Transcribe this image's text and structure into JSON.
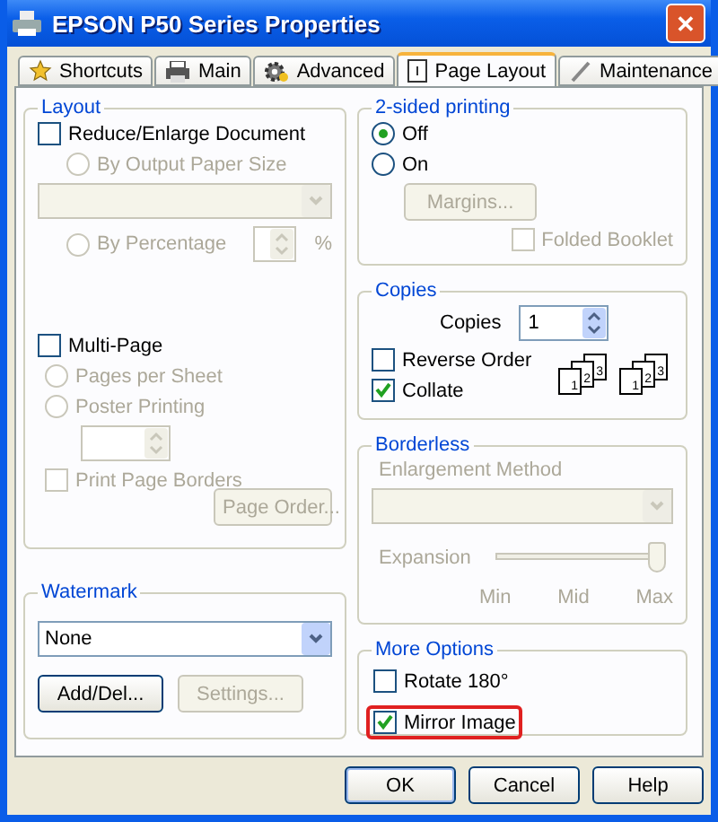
{
  "window": {
    "title": "EPSON P50 Series Properties",
    "close": "✕"
  },
  "tabs": [
    {
      "label": "Shortcuts",
      "selected": false
    },
    {
      "label": "Main",
      "selected": false
    },
    {
      "label": "Advanced",
      "selected": false
    },
    {
      "label": "Page Layout",
      "selected": true
    },
    {
      "label": "Maintenance",
      "selected": false
    }
  ],
  "layout": {
    "title": "Layout",
    "reduce_enlarge": {
      "label": "Reduce/Enlarge Document",
      "checked": false,
      "disabled": false
    },
    "by_output_paper_size": {
      "label": "By Output Paper Size",
      "selected": false,
      "disabled": true
    },
    "by_percentage": {
      "label": "By Percentage",
      "selected": false,
      "disabled": true
    },
    "percent_unit": "%",
    "multi_page": {
      "label": "Multi-Page",
      "checked": false,
      "disabled": false
    },
    "pages_per_sheet": {
      "label": "Pages per Sheet",
      "selected": false,
      "disabled": true
    },
    "poster_printing": {
      "label": "Poster Printing",
      "selected": false,
      "disabled": true
    },
    "print_page_borders": {
      "label": "Print Page Borders",
      "checked": false,
      "disabled": true
    },
    "page_order_button": {
      "label": "Page Order...",
      "disabled": true
    }
  },
  "watermark": {
    "title": "Watermark",
    "value": "None",
    "add_del_button": {
      "label": "Add/Del...",
      "disabled": false
    },
    "settings_button": {
      "label": "Settings...",
      "disabled": true
    }
  },
  "two_sided": {
    "title": "2-sided printing",
    "options": [
      {
        "label": "Off",
        "selected": true,
        "disabled": false
      },
      {
        "label": "On",
        "selected": false,
        "disabled": false
      }
    ],
    "margins_button": {
      "label": "Margins...",
      "disabled": true
    },
    "folded_booklet": {
      "label": "Folded Booklet",
      "checked": false,
      "disabled": true
    }
  },
  "copies": {
    "title": "Copies",
    "copies_label": "Copies",
    "copies_value": "1",
    "reverse_order": {
      "label": "Reverse Order",
      "checked": false,
      "disabled": false
    },
    "collate": {
      "label": "Collate",
      "checked": true,
      "disabled": false
    },
    "page_stacks": [
      [
        "1",
        "2",
        "3"
      ],
      [
        "1",
        "2",
        "3"
      ]
    ]
  },
  "borderless": {
    "title": "Borderless",
    "enlargement_method": "Enlargement Method",
    "expansion": "Expansion",
    "level": 1,
    "ticks": [
      "Min",
      "Mid",
      "Max"
    ]
  },
  "more_options": {
    "title": "More Options",
    "options": [
      {
        "label": "Rotate 180°",
        "checked": false,
        "disabled": false,
        "highlighted": false
      },
      {
        "label": "Mirror Image",
        "checked": true,
        "disabled": false,
        "highlighted": true
      }
    ]
  },
  "buttons": [
    {
      "label": "OK",
      "default": true
    },
    {
      "label": "Cancel",
      "default": false
    },
    {
      "label": "Help",
      "default": false
    }
  ]
}
